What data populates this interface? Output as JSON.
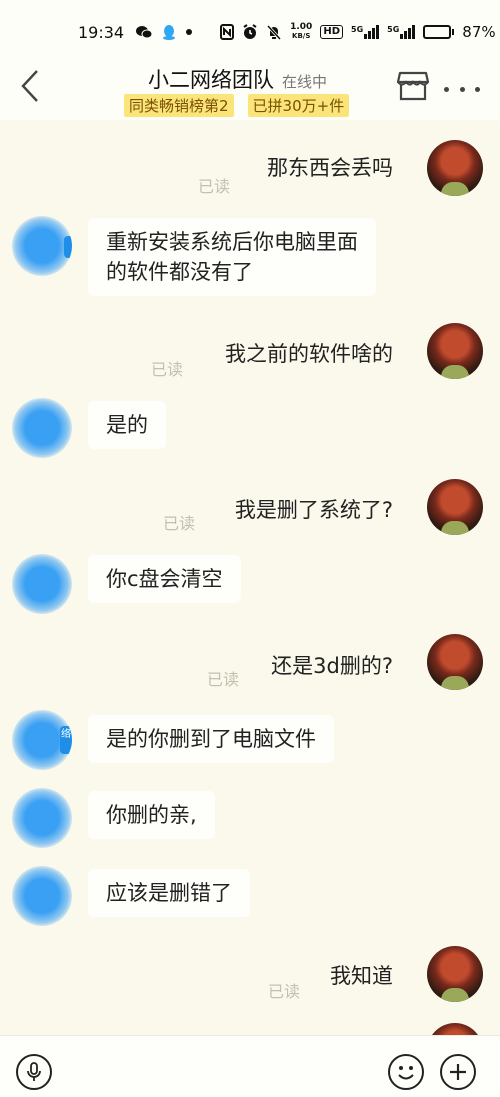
{
  "status_bar": {
    "time": "19:34",
    "net_speed_value": "1.00",
    "net_speed_unit": "KB/S",
    "hd_label": "HD",
    "signal1_label": "5G",
    "signal2_label": "5G",
    "battery_percent": "87%",
    "battery_level": 0.87
  },
  "header": {
    "title": "小二网络团队",
    "presence": "在线中",
    "tags": [
      "同类畅销榜第2",
      "已拼30万+件"
    ]
  },
  "messages": [
    {
      "side": "me",
      "text": "那东西会丢吗",
      "read": "已读"
    },
    {
      "side": "other",
      "lines": [
        "重新安装系统后你电脑里面",
        "的软件都没有了"
      ]
    },
    {
      "side": "me",
      "text": "我之前的软件啥的",
      "read": "已读"
    },
    {
      "side": "other",
      "lines": [
        "是的"
      ]
    },
    {
      "side": "me",
      "text": "我是删了系统了?",
      "read": "已读"
    },
    {
      "side": "other",
      "lines": [
        "你c盘会清空"
      ]
    },
    {
      "side": "me",
      "text": "还是3d删的?",
      "read": "已读"
    },
    {
      "side": "other",
      "lines": [
        "是的你删到了电脑文件"
      ],
      "avatar_edge_text": "络"
    },
    {
      "side": "other",
      "lines": [
        "你删的亲,"
      ]
    },
    {
      "side": "other",
      "lines": [
        "应该是删错了"
      ]
    },
    {
      "side": "me",
      "text": "我知道",
      "read": "已读"
    }
  ],
  "colors": {
    "background": "#fbf9ec",
    "tag_background": "#fbe57a",
    "other_avatar": "#3aa0f4"
  },
  "icons": {
    "back": "chevron-left-icon",
    "shop": "storefront-icon",
    "more": "more-dots-icon",
    "mic": "microphone-icon",
    "emoji": "smiley-icon",
    "plus": "plus-icon"
  }
}
